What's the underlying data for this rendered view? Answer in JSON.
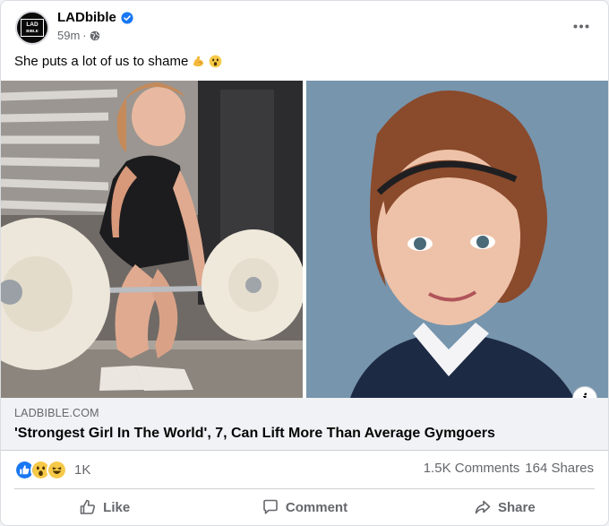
{
  "post": {
    "page_name": "LADbible",
    "avatar_text_top": "LAD",
    "avatar_text_bottom": "BIBLE",
    "time": "59m",
    "separator": "·",
    "caption": "She puts a lot of us to shame",
    "caption_emojis": [
      "flexed-biceps-emoji",
      "astonished-face-emoji"
    ]
  },
  "link": {
    "domain": "LADBIBLE.COM",
    "headline": "'Strongest Girl In The World', 7, Can Lift More Than Average Gymgoers",
    "info_label": "i"
  },
  "engagement": {
    "reaction_icons": [
      "like-reaction-icon",
      "wow-reaction-icon",
      "haha-reaction-icon"
    ],
    "reaction_count": "1K",
    "comments": "1.5K Comments",
    "shares": "164 Shares"
  },
  "actions": {
    "like": "Like",
    "comment": "Comment",
    "share": "Share"
  },
  "colors": {
    "verified": "#1877f2",
    "text_primary": "#050505",
    "text_secondary": "#65676b",
    "link_bg": "#f0f2f5"
  }
}
